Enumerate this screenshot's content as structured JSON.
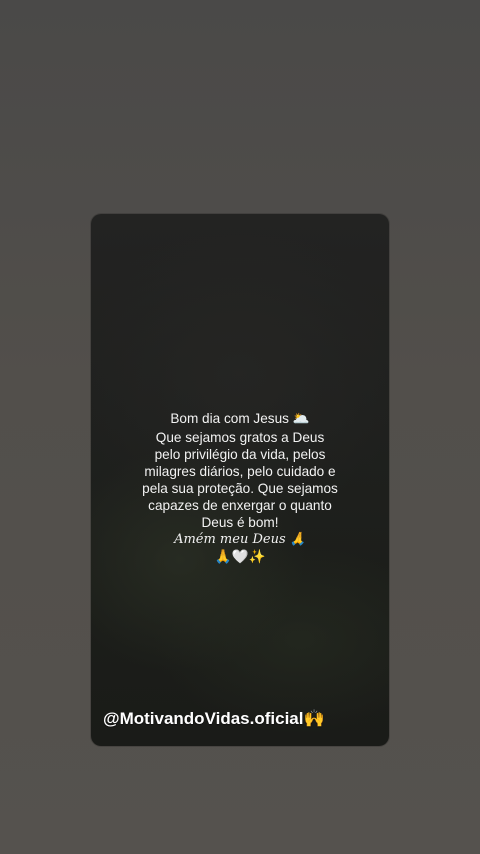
{
  "story": {
    "greeting": "Bom dia com Jesus 🌥️",
    "body_lines": [
      "Que sejamos gratos a Deus",
      "pelo privilégio da vida, pelos",
      "milagres diários, pelo cuidado e",
      "pela sua proteção. Que sejamos",
      "capazes de enxergar o quanto",
      "Deus é bom!"
    ],
    "amen": "Amém meu Deus 🙏",
    "emojis": "🙏🤍✨",
    "handle": "@MotivandoVidas.oficial🙌"
  },
  "colors": {
    "outer_background": "#4f4d4a",
    "card_background": "#1f201e",
    "text": "#f2f2f2"
  }
}
